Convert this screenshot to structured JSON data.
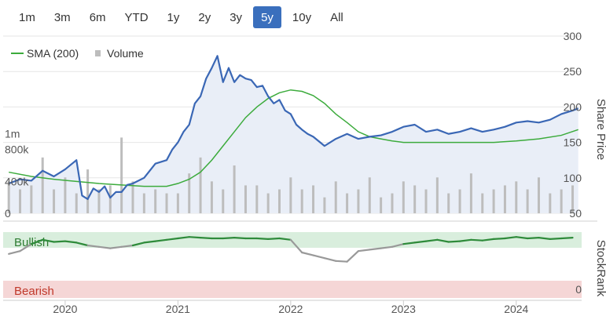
{
  "range_selector": {
    "buttons": [
      "1m",
      "3m",
      "6m",
      "YTD",
      "1y",
      "2y",
      "3y",
      "5y",
      "10y",
      "All"
    ],
    "active": "5y"
  },
  "legend": {
    "sma_label": "SMA (200)",
    "volume_label": "Volume"
  },
  "colors": {
    "price": "#3a67b5",
    "sma": "#3cab3c",
    "volume": "#bdbdbd",
    "bullish_band": "#d9eedd",
    "bearish_band": "#f5d6d6",
    "rank_good": "#2e8b3a",
    "rank_bad": "#999999"
  },
  "chart_data": [
    {
      "type": "line",
      "xlabel": "",
      "ylabel": "Share Price",
      "ylim": [
        50,
        300
      ],
      "y_ticks": [
        "300",
        "250",
        "200",
        "150",
        "100",
        "50"
      ],
      "volume_axis": {
        "ticks": [
          "1m",
          "800k",
          "400k",
          "0"
        ],
        "ylim": [
          0,
          1200000
        ]
      },
      "x_ticks": [
        "2020",
        "2021",
        "2022",
        "2023",
        "2024"
      ],
      "series": [
        {
          "name": "",
          "x": [
            2019.5,
            2019.6,
            2019.7,
            2019.8,
            2019.9,
            2020.0,
            2020.1,
            2020.15,
            2020.2,
            2020.25,
            2020.3,
            2020.35,
            2020.4,
            2020.45,
            2020.5,
            2020.55,
            2020.6,
            2020.7,
            2020.8,
            2020.9,
            2020.95,
            2021.0,
            2021.05,
            2021.1,
            2021.15,
            2021.2,
            2021.25,
            2021.3,
            2021.35,
            2021.4,
            2021.45,
            2021.5,
            2021.55,
            2021.6,
            2021.65,
            2021.7,
            2021.75,
            2021.8,
            2021.85,
            2021.9,
            2021.95,
            2022.0,
            2022.05,
            2022.1,
            2022.15,
            2022.2,
            2022.3,
            2022.4,
            2022.5,
            2022.6,
            2022.7,
            2022.8,
            2022.9,
            2023.0,
            2023.1,
            2023.2,
            2023.3,
            2023.4,
            2023.5,
            2023.6,
            2023.7,
            2023.8,
            2023.9,
            2024.0,
            2024.1,
            2024.2,
            2024.3,
            2024.4,
            2024.5,
            2024.55
          ],
          "values": [
            92,
            98,
            96,
            110,
            102,
            112,
            125,
            75,
            70,
            85,
            80,
            88,
            72,
            80,
            80,
            90,
            92,
            100,
            120,
            125,
            140,
            150,
            165,
            175,
            205,
            215,
            240,
            255,
            272,
            235,
            255,
            235,
            245,
            240,
            238,
            228,
            230,
            215,
            205,
            210,
            195,
            190,
            175,
            168,
            162,
            158,
            145,
            155,
            162,
            155,
            158,
            160,
            165,
            172,
            175,
            165,
            168,
            162,
            165,
            170,
            165,
            168,
            172,
            178,
            180,
            178,
            182,
            190,
            195,
            198
          ]
        },
        {
          "name": "SMA (200)",
          "x": [
            2019.5,
            2019.7,
            2019.9,
            2020.1,
            2020.3,
            2020.5,
            2020.7,
            2020.9,
            2021.0,
            2021.1,
            2021.2,
            2021.3,
            2021.4,
            2021.5,
            2021.6,
            2021.7,
            2021.8,
            2021.9,
            2022.0,
            2022.1,
            2022.2,
            2022.3,
            2022.4,
            2022.5,
            2022.6,
            2022.7,
            2022.8,
            2022.9,
            2023.0,
            2023.2,
            2023.4,
            2023.6,
            2023.8,
            2024.0,
            2024.2,
            2024.4,
            2024.55
          ],
          "values": [
            108,
            102,
            98,
            95,
            92,
            90,
            88,
            88,
            92,
            98,
            108,
            125,
            145,
            165,
            185,
            200,
            212,
            220,
            224,
            222,
            216,
            205,
            190,
            178,
            165,
            158,
            155,
            152,
            150,
            150,
            150,
            150,
            150,
            152,
            155,
            160,
            168
          ]
        },
        {
          "name": "Volume",
          "x": [
            2019.5,
            2019.6,
            2019.7,
            2019.8,
            2019.9,
            2020.0,
            2020.1,
            2020.2,
            2020.3,
            2020.4,
            2020.5,
            2020.6,
            2020.7,
            2020.8,
            2020.9,
            2021.0,
            2021.1,
            2021.2,
            2021.3,
            2021.4,
            2021.5,
            2021.6,
            2021.7,
            2021.8,
            2021.9,
            2022.0,
            2022.1,
            2022.2,
            2022.3,
            2022.4,
            2022.5,
            2022.6,
            2022.7,
            2022.8,
            2022.9,
            2023.0,
            2023.1,
            2023.2,
            2023.3,
            2023.4,
            2023.5,
            2023.6,
            2023.7,
            2023.8,
            2023.9,
            2024.0,
            2024.1,
            2024.2,
            2024.3,
            2024.4,
            2024.5
          ],
          "values": [
            400000,
            300000,
            350000,
            700000,
            300000,
            450000,
            250000,
            550000,
            300000,
            350000,
            950000,
            400000,
            250000,
            300000,
            250000,
            250000,
            500000,
            700000,
            400000,
            300000,
            600000,
            350000,
            350000,
            250000,
            300000,
            450000,
            300000,
            350000,
            200000,
            400000,
            250000,
            300000,
            450000,
            200000,
            250000,
            400000,
            350000,
            300000,
            450000,
            250000,
            300000,
            500000,
            250000,
            300000,
            350000,
            400000,
            300000,
            450000,
            250000,
            300000,
            350000
          ]
        }
      ]
    },
    {
      "type": "area",
      "ylabel": "StockRank",
      "ylim": [
        0,
        100
      ],
      "band_labels": {
        "top": "Bullish",
        "bottom": "Bearish"
      },
      "right_tick": "0",
      "x": [
        2019.5,
        2019.6,
        2019.7,
        2019.8,
        2019.9,
        2020.0,
        2020.1,
        2020.2,
        2020.3,
        2020.4,
        2020.5,
        2020.6,
        2020.7,
        2020.8,
        2020.9,
        2021.0,
        2021.1,
        2021.2,
        2021.3,
        2021.4,
        2021.5,
        2021.6,
        2021.7,
        2021.8,
        2021.9,
        2022.0,
        2022.1,
        2022.2,
        2022.3,
        2022.4,
        2022.5,
        2022.6,
        2022.7,
        2022.8,
        2022.9,
        2023.0,
        2023.1,
        2023.2,
        2023.3,
        2023.4,
        2023.5,
        2023.6,
        2023.7,
        2023.8,
        2023.9,
        2024.0,
        2024.1,
        2024.2,
        2024.3,
        2024.4,
        2024.5
      ],
      "values": [
        68,
        72,
        82,
        88,
        85,
        86,
        84,
        80,
        78,
        76,
        78,
        80,
        84,
        86,
        88,
        90,
        92,
        91,
        90,
        90,
        91,
        90,
        90,
        89,
        90,
        88,
        70,
        66,
        62,
        58,
        57,
        72,
        74,
        76,
        78,
        82,
        84,
        86,
        88,
        85,
        86,
        88,
        87,
        89,
        90,
        92,
        90,
        91,
        89,
        90,
        91
      ]
    }
  ]
}
